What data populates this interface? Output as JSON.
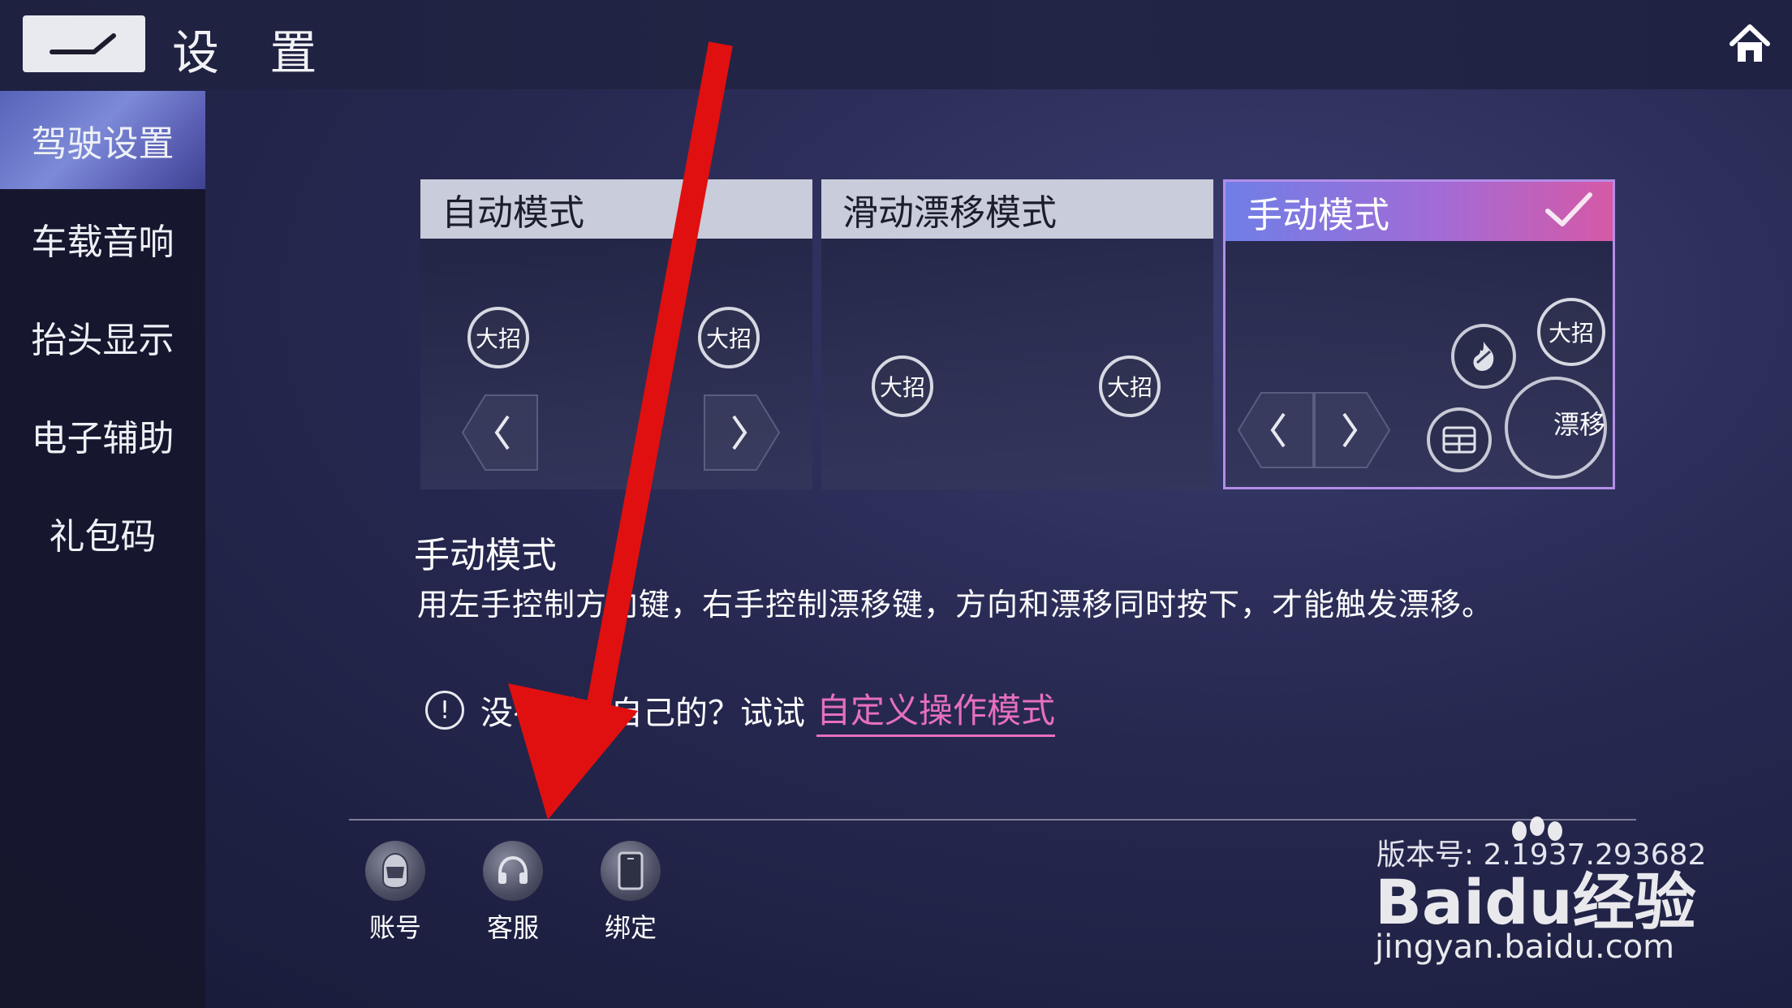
{
  "header": {
    "title": "设 置"
  },
  "sidebar": {
    "items": [
      {
        "label": "驾驶设置",
        "active": true
      },
      {
        "label": "车载音响"
      },
      {
        "label": "抬头显示"
      },
      {
        "label": "电子辅助"
      },
      {
        "label": "礼包码"
      }
    ]
  },
  "modes": [
    {
      "title": "自动模式",
      "ult_label": "大招",
      "selected": false
    },
    {
      "title": "滑动漂移模式",
      "ult_label": "大招",
      "selected": false
    },
    {
      "title": "手动模式",
      "ult_label": "大招",
      "drift_label": "漂移",
      "selected": true
    }
  ],
  "description": {
    "title": "手动模式",
    "text": "用左手控制方向键，右手控制漂移键，方向和漂移同时按下，才能触发漂移。"
  },
  "hint": {
    "icon": "!",
    "text": "没有适合自己的？试试",
    "link": "自定义操作模式"
  },
  "bottom": {
    "buttons": [
      {
        "label": "账号",
        "icon": "helmet-icon"
      },
      {
        "label": "客服",
        "icon": "headset-icon"
      },
      {
        "label": "绑定",
        "icon": "phone-icon"
      }
    ],
    "version": "版本号: 2.1937.293682"
  },
  "watermark": {
    "logo": "Baidu经验",
    "url": "jingyan.baidu.com"
  },
  "colors": {
    "accent_pink": "#e66fbe",
    "active_tab": "#7c8ad8",
    "annotation_arrow": "#e01010"
  }
}
